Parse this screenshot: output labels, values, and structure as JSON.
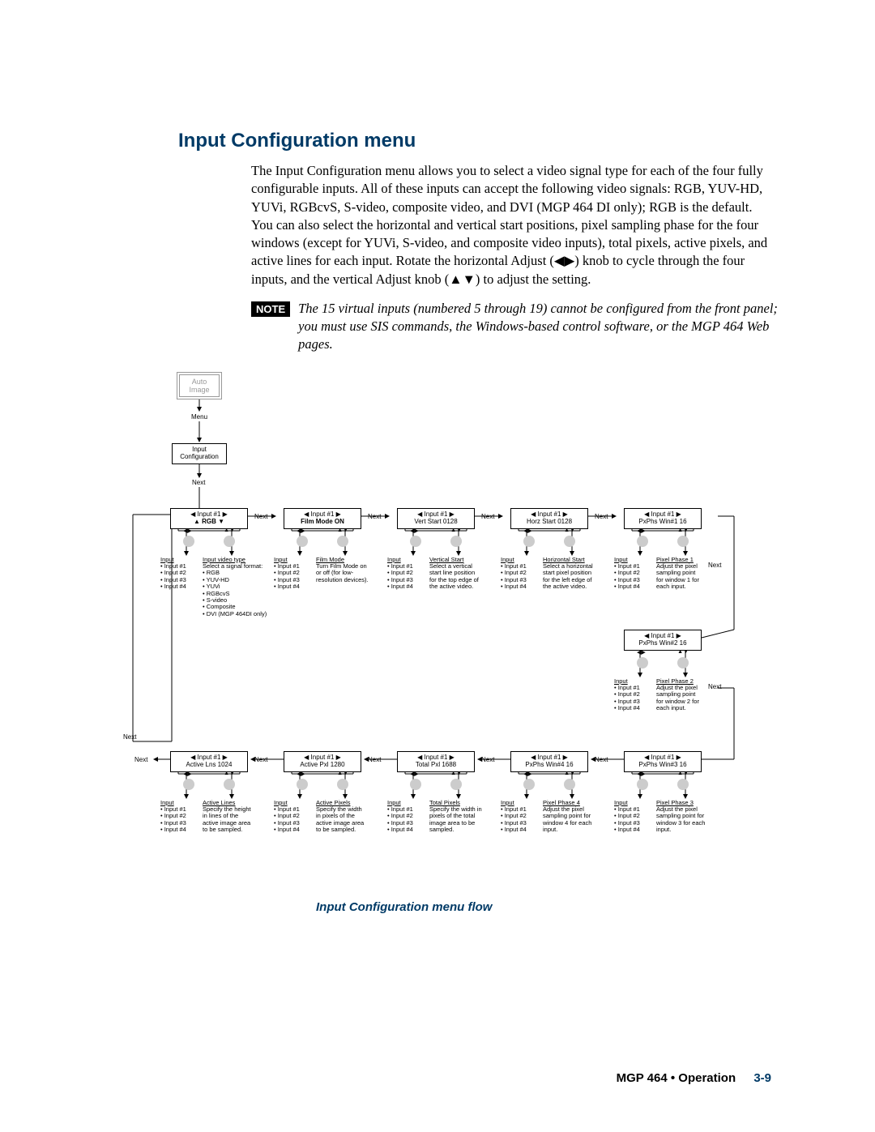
{
  "section_title": "Input Configuration menu",
  "paragraph": "The Input Configuration menu allows you to select a video signal type for each of the four fully configurable inputs.  All of these inputs can accept the following video signals: RGB, YUV-HD, YUVi, RGBcvS, S-video, composite video, and DVI (MGP 464 DI only); RGB is the default.  You can also select the horizontal and vertical start positions, pixel sampling phase for the four windows (except for YUVi, S-video, and composite video inputs), total pixels, active pixels, and active lines for each input.  Rotate the horizontal Adjust (◀▶) knob to cycle through the four inputs, and the vertical Adjust knob (▲▼) to adjust the setting.",
  "note_label": "NOTE",
  "note_text": "The 15 virtual inputs (numbered 5 through 19) cannot be configured from the front panel; you must use SIS commands, the Windows-based control software, or the MGP 464 Web pages.",
  "flow_caption": "Input Configuration menu flow",
  "footer_text": "MGP 464 • Operation",
  "footer_page": "3-9",
  "labels": {
    "menu": "Menu",
    "next": "Next",
    "input_config": "Input\nConfiguration",
    "auto_image": "Auto\nImage"
  },
  "screens_row1": [
    {
      "top": "◀  Input #1  ▶",
      "bottom_b": "▲    RGB     ▼"
    },
    {
      "top": "◀  Input #1  ▶",
      "bottom_b": "Film Mode   ON"
    },
    {
      "top": "◀  Input #1  ▶",
      "bottom": "Vert Start   0128"
    },
    {
      "top": "◀  Input #1  ▶",
      "bottom": "Horz Start   0128"
    },
    {
      "top": "◀  Input #1  ▶",
      "bottom": "PxPhs Win#1   16"
    }
  ],
  "screen_mid": {
    "top": "◀  Input #1  ▶",
    "bottom": "PxPhs Win#2   16"
  },
  "screens_row2": [
    {
      "top": "◀  Input #1  ▶",
      "bottom": "Active Lns   1024"
    },
    {
      "top": "◀  Input #1  ▶",
      "bottom": "Active Pxl   1280"
    },
    {
      "top": "◀  Input #1  ▶",
      "bottom": "Total Pxl   1688"
    },
    {
      "top": "◀  Input #1  ▶",
      "bottom": "PxPhs Win#4   16"
    },
    {
      "top": "◀  Input #1  ▶",
      "bottom": "PxPhs Win#3   16"
    }
  ],
  "desc_input_list": {
    "header": "Input",
    "items": [
      "Input #1",
      "Input #2",
      "Input #3",
      "Input #4"
    ]
  },
  "desc_blocks_row1": [
    {
      "header": "Input video type",
      "lines": [
        "Select a signal format:"
      ],
      "items": [
        "RGB",
        "YUV-HD",
        "YUVi",
        "RGBcvS",
        "S-video",
        "Composite",
        "DVI (MGP 464DI only)"
      ]
    },
    {
      "header": "Film Mode",
      "lines": [
        "Turn Film Mode on",
        "or off (for low-",
        "resolution devices)."
      ]
    },
    {
      "header": "Vertical Start",
      "lines": [
        "Select a vertical",
        "start line position",
        "for the top edge of",
        "the active video."
      ]
    },
    {
      "header": "Horizontal Start",
      "lines": [
        "Select a horizontal",
        "start pixel position",
        "for the left edge of",
        "the active video."
      ]
    },
    {
      "header": "Pixel Phase 1",
      "lines": [
        "Adjust the pixel",
        "sampling point",
        "for window 1 for",
        "each input."
      ]
    }
  ],
  "desc_mid": {
    "header": "Pixel Phase 2",
    "lines": [
      "Adjust the pixel",
      "sampling point",
      "for window 2 for",
      "each input."
    ]
  },
  "desc_blocks_row2": [
    {
      "header": "Active Lines",
      "lines": [
        "Specify the height",
        "in lines of the",
        "active image area",
        "to be sampled."
      ]
    },
    {
      "header": "Active Pixels",
      "lines": [
        "Specify the width",
        "in pixels of the",
        "active image area",
        "to be sampled."
      ]
    },
    {
      "header": "Total Pixels",
      "lines": [
        "Specify the width in",
        "pixels of the total",
        "image area to be",
        "sampled."
      ]
    },
    {
      "header": "Pixel Phase 4",
      "lines": [
        "Adjust the pixel",
        "sampling point for",
        "window 4 for each",
        "input."
      ]
    },
    {
      "header": "Pixel Phase 3",
      "lines": [
        "Adjust the pixel",
        "sampling point for",
        "window 3 for each",
        "input."
      ]
    }
  ]
}
